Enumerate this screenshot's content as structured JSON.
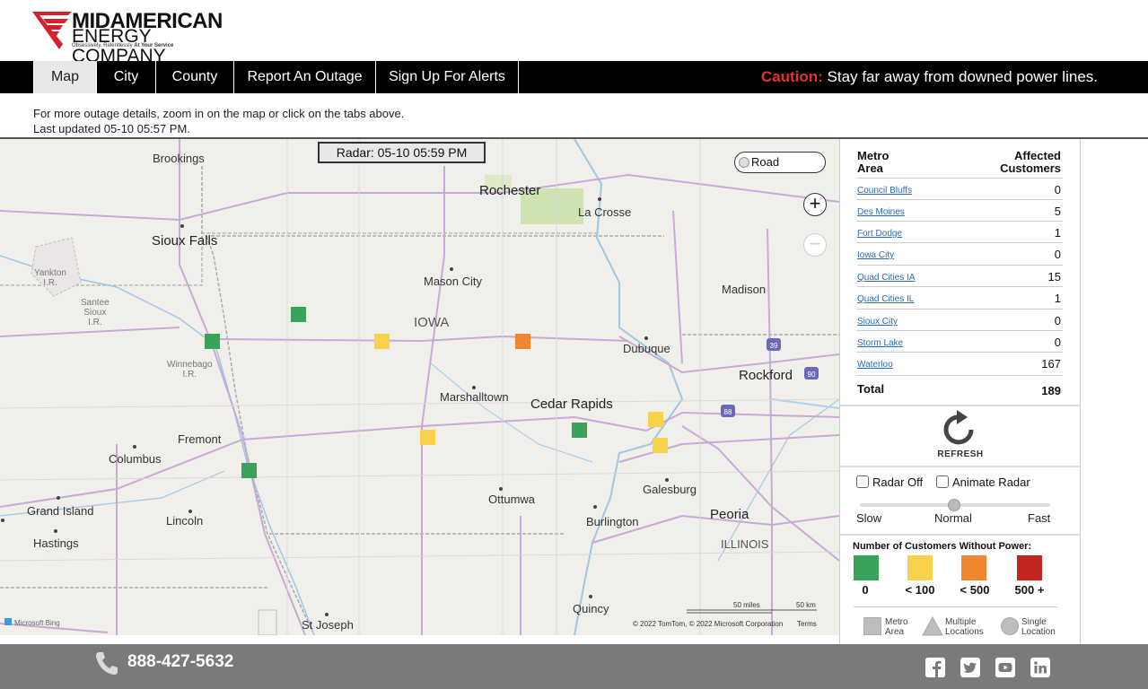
{
  "logo": {
    "line1": "MIDAMERICAN",
    "line2": "ENERGY COMPANY",
    "tagline_a": "Obsessively, Relentlessly",
    "tagline_b": "At Your Service",
    "brand_color": "#d4212b"
  },
  "nav": {
    "tabs": [
      {
        "label": "Map",
        "active": true
      },
      {
        "label": "City"
      },
      {
        "label": "County"
      },
      {
        "label": "Report An Outage"
      },
      {
        "label": "Sign Up For Alerts"
      }
    ],
    "caution_word": "Caution:",
    "caution_text": "Stay far away from downed power lines."
  },
  "info": {
    "line1": "For more outage details, zoom in on the map or click on the tabs above.",
    "line2": "Last updated 05-10 05:57 PM."
  },
  "map": {
    "radar_label": "Radar: 05-10 05:59 PM",
    "style_button": "Road",
    "zoom_in_icon": "plus-icon",
    "zoom_out_icon": "minus-icon",
    "places": {
      "brookings": "Brookings",
      "rochester": "Rochester",
      "la_crosse": "La Crosse",
      "sioux_falls": "Sioux Falls",
      "yankton": "Yankton\nI.R.",
      "santee": "Santee\nSioux\nI.R.",
      "mason_city": "Mason City",
      "madison": "Madison",
      "iowa": "IOWA",
      "dubuque": "Dubuque",
      "winnebago": "Winnebago\nI.R.",
      "rockford": "Rockford",
      "marshalltown": "Marshalltown",
      "cedar_rapids": "Cedar Rapids",
      "fremont": "Fremont",
      "columbus": "Columbus",
      "galesburg": "Galesburg",
      "ottumwa": "Ottumwa",
      "grand_island": "Grand Island",
      "lincoln": "Lincoln",
      "burlington": "Burlington",
      "peoria": "Peoria",
      "hastings": "Hastings",
      "illinois": "ILLINOIS",
      "quincy": "Quincy",
      "st_joseph": "St Joseph"
    },
    "highways": [
      "39",
      "90",
      "88"
    ],
    "scale_miles": "50 miles",
    "scale_km": "50 km",
    "copyright": "© 2022 TomTom, © 2022 Microsoft Corporation",
    "terms": "Terms",
    "bing": "Microsoft Bing",
    "markers": [
      {
        "level": "green"
      },
      {
        "level": "green"
      },
      {
        "level": "yellow"
      },
      {
        "level": "orange"
      },
      {
        "level": "yellow"
      },
      {
        "level": "yellow"
      },
      {
        "level": "green"
      },
      {
        "level": "yellow"
      },
      {
        "level": "green"
      }
    ]
  },
  "panel": {
    "col_area": "Metro\nArea",
    "col_customers": "Affected\nCustomers",
    "rows": [
      {
        "area": "Council Bluffs",
        "count": "0"
      },
      {
        "area": "Des Moines",
        "count": "5"
      },
      {
        "area": "Fort Dodge",
        "count": "1"
      },
      {
        "area": "Iowa City",
        "count": "0"
      },
      {
        "area": "Quad Cities IA",
        "count": "15"
      },
      {
        "area": "Quad Cities IL",
        "count": "1"
      },
      {
        "area": "Sioux City",
        "count": "0"
      },
      {
        "area": "Storm Lake",
        "count": "0"
      },
      {
        "area": "Waterloo",
        "count": "167"
      }
    ],
    "total_label": "Total",
    "total_value": "189",
    "refresh_label": "REFRESH",
    "radar_off": "Radar Off",
    "animate_radar": "Animate Radar",
    "speed_slow": "Slow",
    "speed_normal": "Normal",
    "speed_fast": "Fast",
    "legend_title": "Number of Customers Without Power:",
    "legend": [
      {
        "label": "0",
        "color": "#3aa35b"
      },
      {
        "label": "< 100",
        "color": "#f7d24a"
      },
      {
        "label": "< 500",
        "color": "#ef8730"
      },
      {
        "label": "500 +",
        "color": "#c3261f"
      }
    ],
    "shape_metro": "Metro\nArea",
    "shape_multiple": "Multiple\nLocations",
    "shape_single": "Single\nLocation"
  },
  "footer": {
    "phone": "888-427-5632",
    "social": [
      "facebook-icon",
      "twitter-icon",
      "youtube-icon",
      "linkedin-icon"
    ]
  },
  "colors": {
    "green": "#3aa35b",
    "yellow": "#f7d24a",
    "orange": "#ef8730",
    "red": "#c3261f",
    "caution": "#e4312b",
    "link": "#2b6ab0"
  }
}
